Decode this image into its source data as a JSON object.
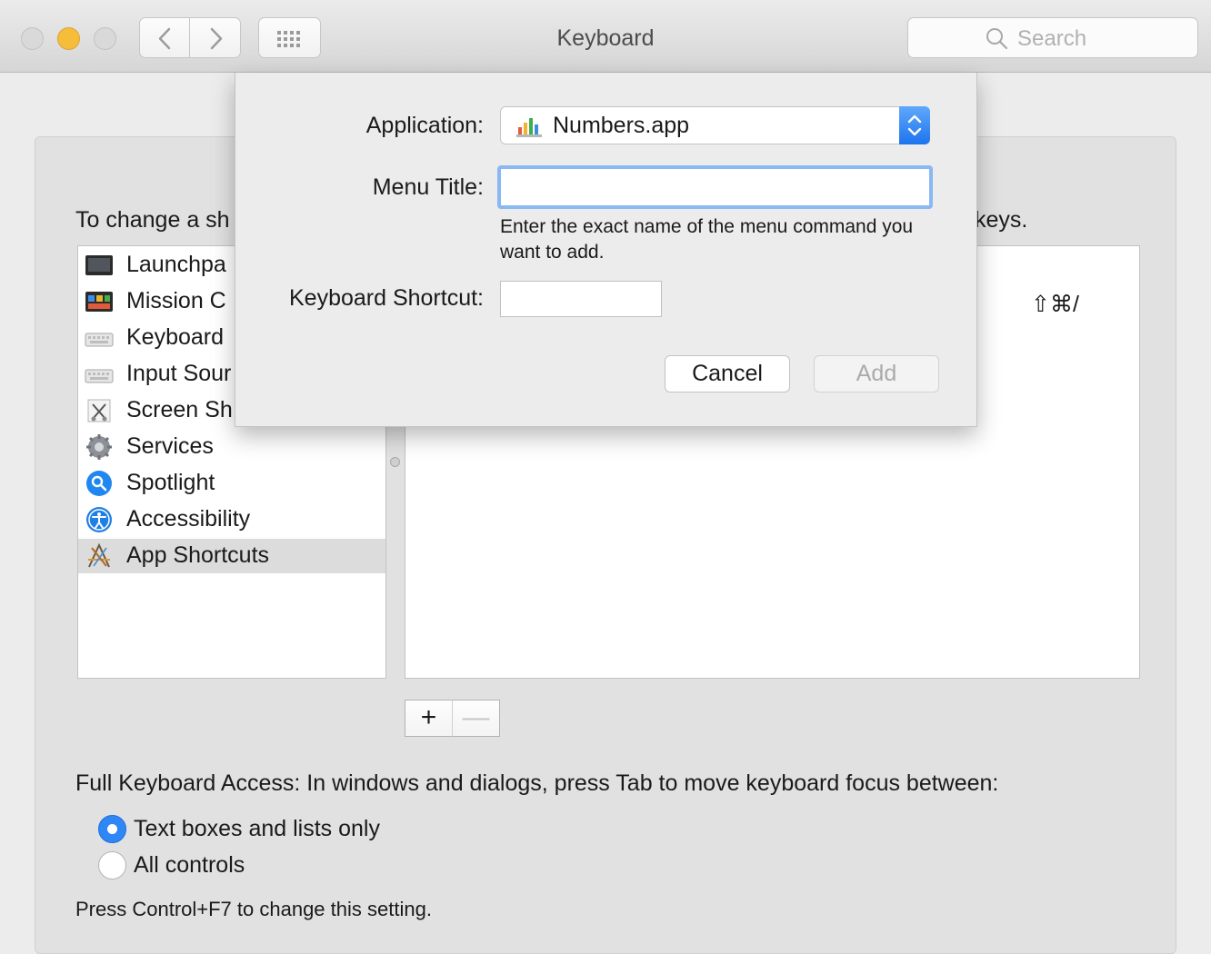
{
  "window": {
    "title": "Keyboard",
    "search_placeholder": "Search"
  },
  "colors": {
    "accent": "#2f86f5",
    "minimize": "#f6bd3b",
    "focus_ring": "#8ab8f2"
  },
  "instruction": {
    "lead": "To change a sh",
    "tail": "keys."
  },
  "categories": [
    {
      "label": "Launchpa",
      "icon": "launchpad-icon"
    },
    {
      "label": "Mission C",
      "icon": "mission-control-icon"
    },
    {
      "label": "Keyboard",
      "icon": "keyboard-icon"
    },
    {
      "label": "Input Sour",
      "icon": "input-sources-icon"
    },
    {
      "label": "Screen Sh",
      "icon": "screenshot-icon"
    },
    {
      "label": "Services",
      "icon": "gear-icon"
    },
    {
      "label": "Spotlight",
      "icon": "spotlight-icon"
    },
    {
      "label": "Accessibility",
      "icon": "accessibility-icon"
    },
    {
      "label": "App Shortcuts",
      "icon": "app-shortcuts-icon",
      "selected": true
    }
  ],
  "shortcut_list": {
    "visible_shortcut": "⇧⌘/"
  },
  "list_buttons": {
    "add": "+",
    "remove": "—"
  },
  "full_keyboard_access": {
    "label": "Full Keyboard Access: In windows and dialogs, press Tab to move keyboard focus between:",
    "options": [
      {
        "label": "Text boxes and lists only",
        "selected": true
      },
      {
        "label": "All controls",
        "selected": false
      }
    ],
    "hint": "Press Control+F7 to change this setting."
  },
  "sheet": {
    "application_label": "Application:",
    "application_value": "Numbers.app",
    "menu_title_label": "Menu Title:",
    "menu_title_value": "",
    "help_text": "Enter the exact name of the menu command you want to add.",
    "shortcut_label": "Keyboard Shortcut:",
    "shortcut_value": "",
    "cancel_label": "Cancel",
    "add_label": "Add"
  }
}
